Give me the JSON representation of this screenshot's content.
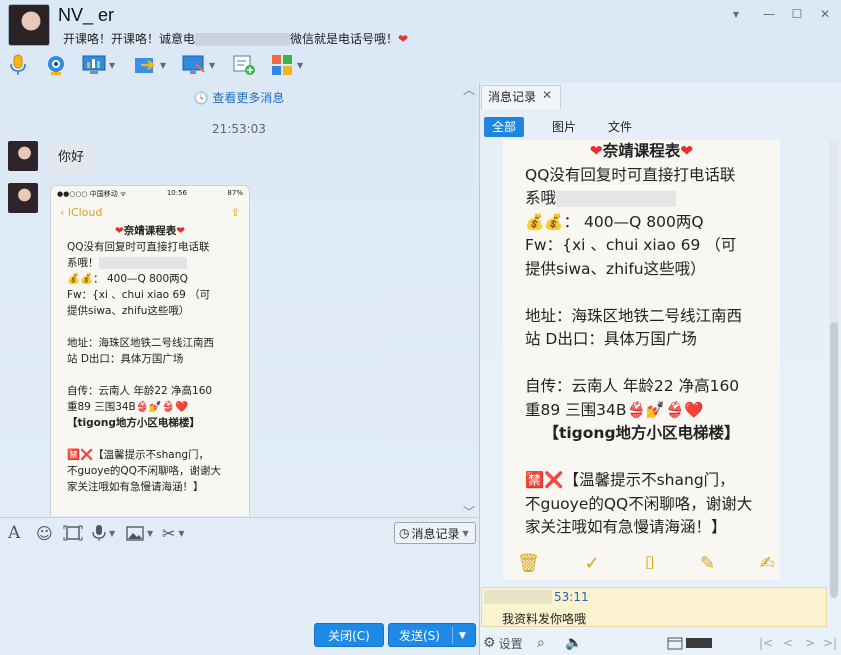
{
  "contact": {
    "name": "NV_ er",
    "signature_before": "开课咯！开课咯！诚意电",
    "signature_after": "微信就是电话号哦！",
    "heart": "❤"
  },
  "window_controls": {
    "dropdown": "▾",
    "minimize": "—",
    "maximize": "☐",
    "close": "✕"
  },
  "toolbar_icons": [
    "microphone-icon",
    "video-call-icon",
    "remote-desktop-icon",
    "file-transfer-icon",
    "screen-share-icon",
    "add-task-icon",
    "apps-icon"
  ],
  "chat": {
    "more_messages": "查看更多消息",
    "timestamp": "21:53:03",
    "hello": "你好"
  },
  "phone_screenshot": {
    "carrier": "●●○○○ 中国移动 ᯤ",
    "time": "10:56",
    "battery": "87%",
    "back_label": "iCloud",
    "title": "奈靖课程表",
    "l1": "QQ没有回复时可直接打电话联",
    "l2": "系哦！",
    "l3": "💰💰：  400—Q  800两Q",
    "l4": "Fw：{xi 、chui xiao  69   （可",
    "l5": "提供siwa、zhifu这些哦）",
    "l6": "地址：海珠区地铁二号线江南西",
    "l7": "站 D出口：具体万国广场",
    "l8": "自传：云南人 年龄22 净高160",
    "l9": "重89  三围34B👙💅👙❤️",
    "l10": "【tigong地方小区电梯楼】",
    "l11": "🈲❌【温馨提示不shang门，",
    "l12": "不guoye的QQ不闲聊咯，谢谢大",
    "l13": "家关注哦如有急慢请海涵！】"
  },
  "input_toolbar": {
    "history_label": "消息记录",
    "icons": [
      "font-icon",
      "emoji-icon",
      "screenshot-icon",
      "voice-icon",
      "image-icon",
      "scissors-icon"
    ]
  },
  "buttons": {
    "close": "关闭(C)",
    "send": "发送(S)"
  },
  "history": {
    "tab_label": "消息记录",
    "filters": [
      "全部",
      "图片",
      "文件"
    ],
    "title": "奈靖课程表",
    "l1": "QQ没有回复时可直接打电话联",
    "l2": "系哦",
    "l3": "💰💰：  400—Q  800两Q",
    "l4": "Fw：{xi 、chui xiao  69  （可",
    "l5": "提供siwa、zhifu这些哦）",
    "l6": "地址：海珠区地铁二号线江南西",
    "l7": "站 D出口：具体万国广场",
    "l8": "自传：云南人 年龄22 净高160",
    "l9": "重89  三围34B👙💅👙❤️",
    "l10": "【tigong地方小区电梯楼】",
    "l11": "🈲❌【温馨提示不shang门，",
    "l12": "不guoye的QQ不闲聊咯，谢谢大",
    "l13": "家关注哦如有急慢请海涵！】",
    "last_time": "53:11",
    "last_text": "我资料发你咯哦",
    "settings_label": "设置"
  }
}
